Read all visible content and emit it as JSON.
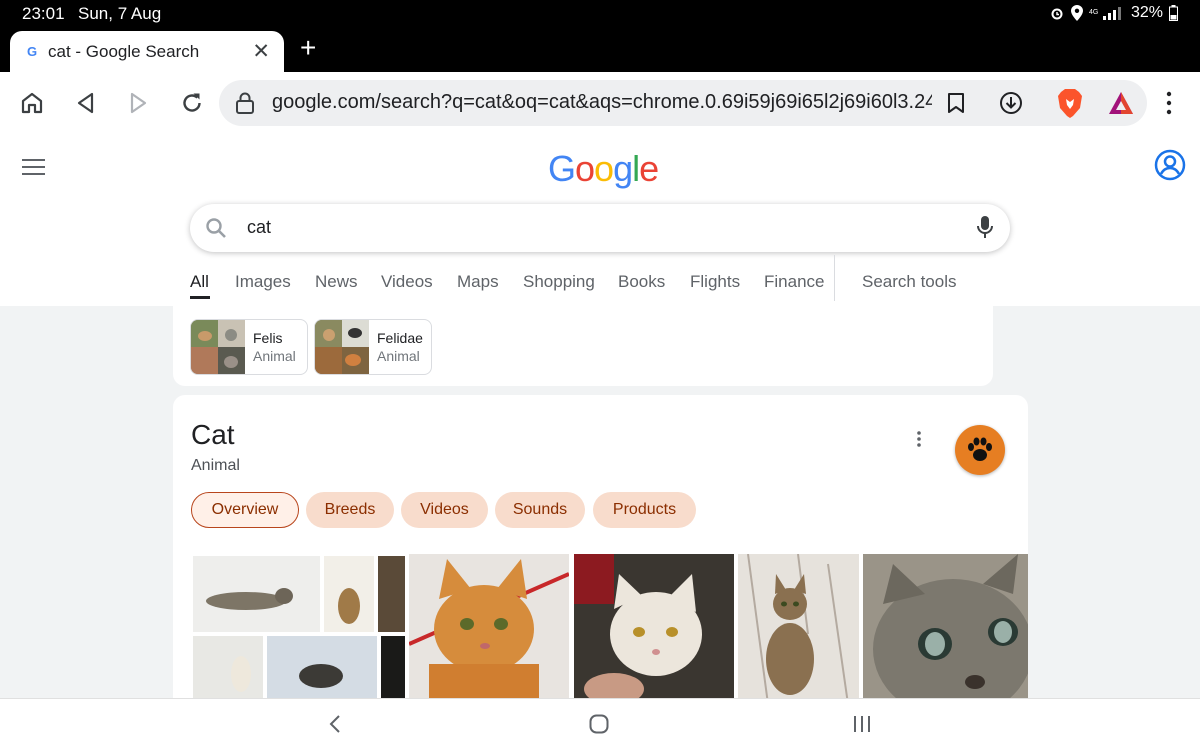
{
  "status_bar": {
    "time": "23:01",
    "date": "Sun, 7 Aug",
    "battery": "32%",
    "icons": [
      "alarm-icon",
      "location-icon",
      "signal-icon",
      "battery-icon"
    ]
  },
  "tab": {
    "title": "cat - Google Search",
    "favicon": "G",
    "close_glyph": "✕",
    "new_tab_glyph": "+"
  },
  "toolbar": {
    "url": "google.com/search?q=cat&oq=cat&aqs=chrome.0.69i59j69i65l2j69i60l3.24"
  },
  "google": {
    "logo_letters": [
      "G",
      "o",
      "o",
      "g",
      "l",
      "e"
    ],
    "logo_colors": [
      "#4285F4",
      "#EA4335",
      "#FBBC05",
      "#4285F4",
      "#34A853",
      "#EA4335"
    ],
    "query": "cat",
    "tabs": [
      "All",
      "Images",
      "News",
      "Videos",
      "Maps",
      "Shopping",
      "Books",
      "Flights",
      "Finance"
    ],
    "search_tools": "Search tools"
  },
  "chips": [
    {
      "name": "Felis",
      "type": "Animal"
    },
    {
      "name": "Felidae",
      "type": "Animal"
    }
  ],
  "knowledge": {
    "title": "Cat",
    "subtitle": "Animal",
    "pills": [
      "Overview",
      "Breeds",
      "Videos",
      "Sounds",
      "Products"
    ],
    "accent": "#b8451c"
  }
}
